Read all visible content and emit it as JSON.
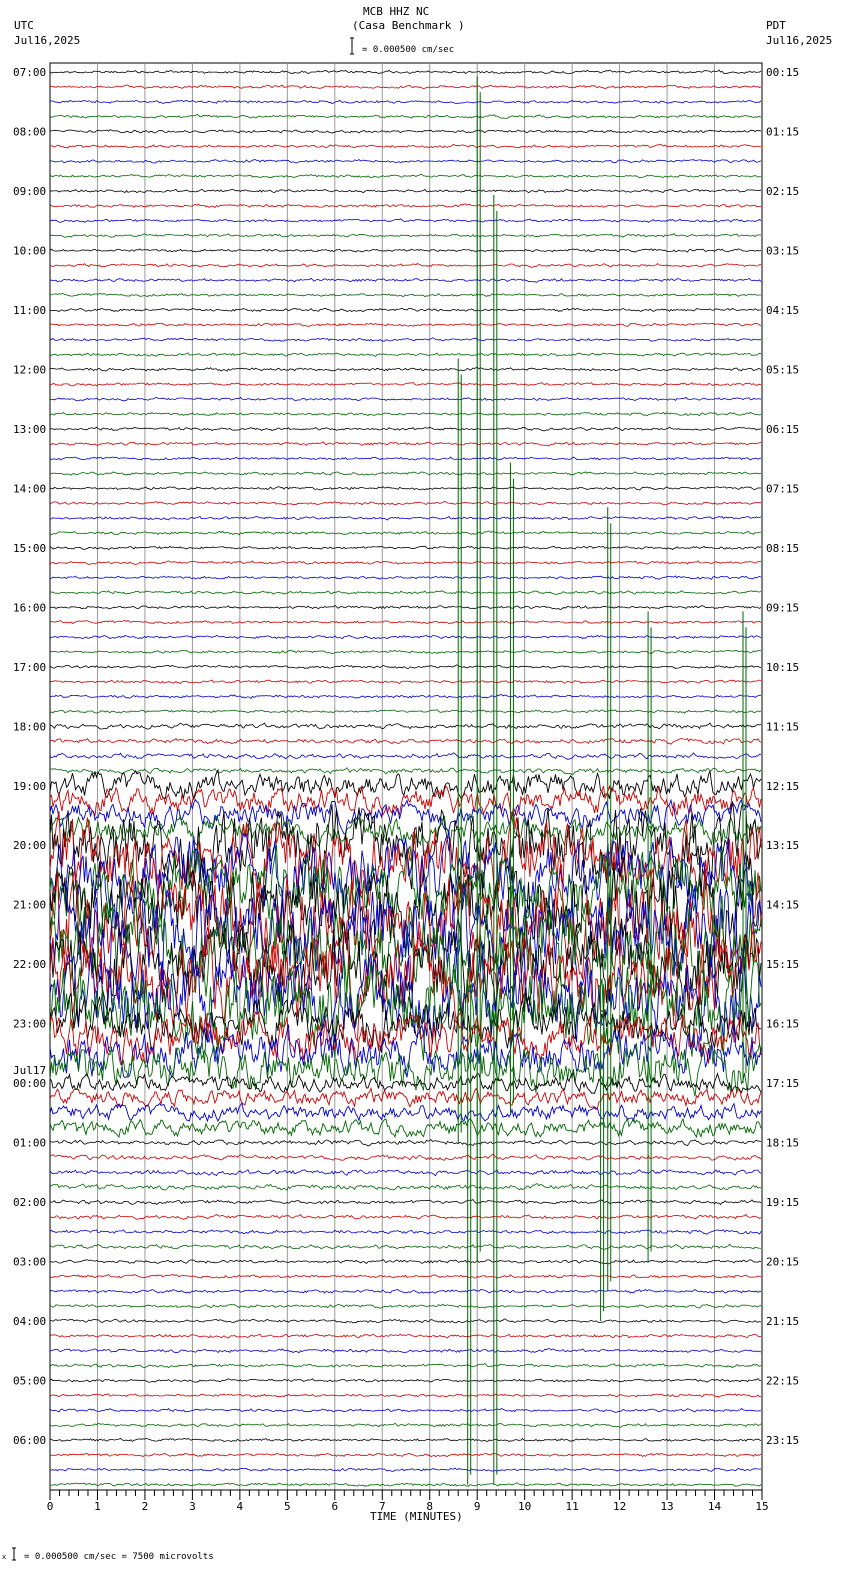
{
  "header": {
    "station": "MCB HHZ NC",
    "location": "(Casa Benchmark )",
    "left_tz": "UTC",
    "left_date": "Jul16,2025",
    "right_tz": "PDT",
    "right_date": "Jul16,2025",
    "scale": "= 0.000500 cm/sec"
  },
  "footer": {
    "scale": "= 0.000500 cm/sec =    7500 microvolts",
    "mark": "x"
  },
  "chart_data": {
    "type": "line",
    "title": "MCB HHZ NC (Casa Benchmark )",
    "xlabel": "TIME (MINUTES)",
    "xlim": [
      0,
      15
    ],
    "x_ticks": [
      "0",
      "1",
      "2",
      "3",
      "4",
      "5",
      "6",
      "7",
      "8",
      "9",
      "10",
      "11",
      "12",
      "13",
      "14",
      "15"
    ],
    "traces_per_hour": 4,
    "trace_colors": [
      "#000000",
      "#cc0000",
      "#0000cc",
      "#006600"
    ],
    "left_labels": [
      "07:00",
      "08:00",
      "09:00",
      "10:00",
      "11:00",
      "12:00",
      "13:00",
      "14:00",
      "15:00",
      "16:00",
      "17:00",
      "18:00",
      "19:00",
      "20:00",
      "21:00",
      "22:00",
      "23:00",
      "00:00",
      "01:00",
      "02:00",
      "03:00",
      "04:00",
      "05:00",
      "06:00"
    ],
    "date_change_label": "Jul17",
    "right_labels": [
      "00:15",
      "01:15",
      "02:15",
      "03:15",
      "04:15",
      "05:15",
      "06:15",
      "07:15",
      "08:15",
      "09:15",
      "10:15",
      "11:15",
      "12:15",
      "13:15",
      "14:15",
      "15:15",
      "16:15",
      "17:15",
      "18:15",
      "19:15",
      "20:15",
      "21:15",
      "22:15",
      "23:15"
    ],
    "hourly_amplitude": [
      1,
      1,
      1,
      1,
      1,
      1,
      1,
      1,
      1,
      1,
      1,
      2,
      8,
      22,
      28,
      26,
      14,
      5,
      2,
      1.5,
      1.2,
      1.2,
      1,
      1
    ],
    "events": [
      {
        "minute": 9.0,
        "trace_from": 0,
        "trace_to": 80
      },
      {
        "minute": 9.35,
        "trace_from": 8,
        "trace_to": 95
      },
      {
        "minute": 8.6,
        "trace_from": 19,
        "trace_to": 72
      },
      {
        "minute": 9.7,
        "trace_from": 26,
        "trace_to": 70
      },
      {
        "minute": 11.75,
        "trace_from": 29,
        "trace_to": 82
      },
      {
        "minute": 8.8,
        "trace_from": 60,
        "trace_to": 95
      },
      {
        "minute": 11.6,
        "trace_from": 60,
        "trace_to": 84
      },
      {
        "minute": 12.6,
        "trace_from": 36,
        "trace_to": 80
      },
      {
        "minute": 14.6,
        "trace_from": 36,
        "trace_to": 68
      }
    ]
  }
}
